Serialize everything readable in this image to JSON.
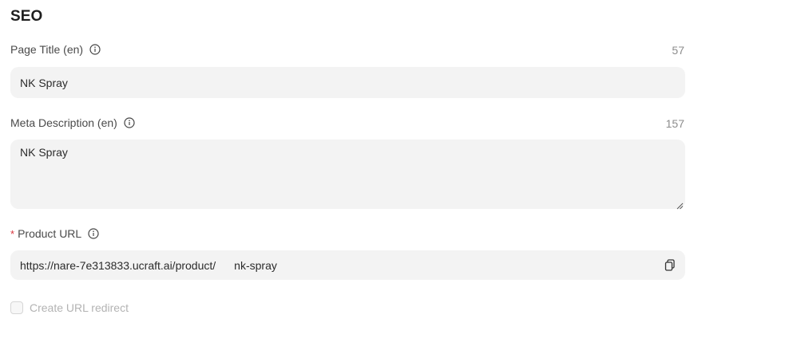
{
  "section": {
    "title": "SEO"
  },
  "page_title": {
    "label": "Page Title (en)",
    "counter": "57",
    "value": "NK Spray"
  },
  "meta_description": {
    "label": "Meta Description (en)",
    "counter": "157",
    "value": "NK Spray"
  },
  "product_url": {
    "required_marker": "*",
    "label": "Product URL",
    "prefix": "https://nare-7e313833.ucraft.ai/product/",
    "slug": "nk-spray"
  },
  "redirect": {
    "label": "Create URL redirect",
    "checked": false
  },
  "icons": {
    "info": "info-icon",
    "copy": "copy-icon"
  }
}
